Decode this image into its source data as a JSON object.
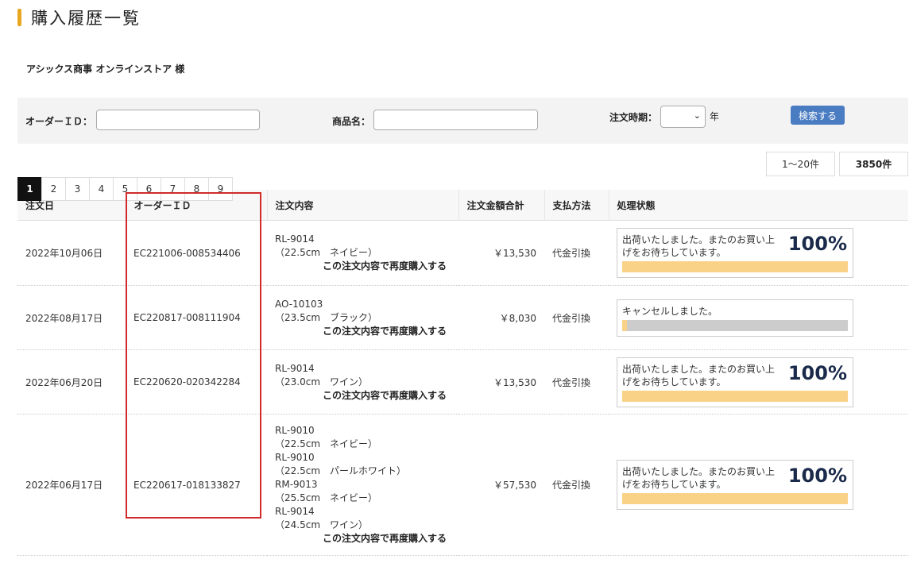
{
  "page": {
    "title": "購入履歴一覧",
    "customer": "アシックス商事 オンラインストア 様"
  },
  "search": {
    "order_id_label": "オーダーＩＤ：",
    "order_id_value": "",
    "product_label": "商品名：",
    "product_value": "",
    "period_label": "注文時期：",
    "period_value": "",
    "year_label": "年",
    "button_label": "検索する"
  },
  "counts": {
    "range": "1〜20件",
    "total": "3850件"
  },
  "pagination": {
    "pages": [
      "1",
      "2",
      "3",
      "4",
      "5",
      "6",
      "7",
      "8",
      "9"
    ],
    "current": "1"
  },
  "table": {
    "headers": [
      "注文日",
      "オーダーＩＤ",
      "注文内容",
      "注文金額合計",
      "支払方法",
      "処理状態"
    ],
    "rows": [
      {
        "date": "2022年10月06日",
        "order_id": "EC221006-008534406",
        "items": [
          {
            "code": "RL-9014",
            "spec": "（22.5cm　ネイビー）"
          }
        ],
        "reorder": "この注文内容で再度購入する",
        "amount": "￥13,530",
        "payment": "代金引換",
        "status": {
          "message": "出荷いたしました。またのお買い上げをお待ちしています。",
          "percent": "100%",
          "progress": 1.0
        }
      },
      {
        "date": "2022年08月17日",
        "order_id": "EC220817-008111904",
        "items": [
          {
            "code": "AO-10103",
            "spec": "（23.5cm　ブラック）"
          }
        ],
        "reorder": "この注文内容で再度購入する",
        "amount": "￥8,030",
        "payment": "代金引換",
        "status": {
          "message": "キャンセルしました。",
          "percent": "",
          "progress": 0.02
        }
      },
      {
        "date": "2022年06月20日",
        "order_id": "EC220620-020342284",
        "items": [
          {
            "code": "RL-9014",
            "spec": "（23.0cm　ワイン）"
          }
        ],
        "reorder": "この注文内容で再度購入する",
        "amount": "￥13,530",
        "payment": "代金引換",
        "status": {
          "message": "出荷いたしました。またのお買い上げをお待ちしています。",
          "percent": "100%",
          "progress": 1.0
        }
      },
      {
        "date": "2022年06月17日",
        "order_id": "EC220617-018133827",
        "items": [
          {
            "code": "RL-9010",
            "spec": "（22.5cm　ネイビー）"
          },
          {
            "code": "RL-9010",
            "spec": "（22.5cm　パールホワイト）"
          },
          {
            "code": "RM-9013",
            "spec": "（25.5cm　ネイビー）"
          },
          {
            "code": "RL-9014",
            "spec": "（24.5cm　ワイン）"
          }
        ],
        "reorder": "この注文内容で再度購入する",
        "amount": "￥57,530",
        "payment": "代金引換",
        "status": {
          "message": "出荷いたしました。またのお買い上げをお待ちしています。",
          "percent": "100%",
          "progress": 1.0
        }
      }
    ]
  },
  "colors": {
    "accent": "#e8a720",
    "button": "#4a7cc2",
    "progress": "#f9d288",
    "cancelled": "#cccccc",
    "highlight": "#d02a2a"
  }
}
